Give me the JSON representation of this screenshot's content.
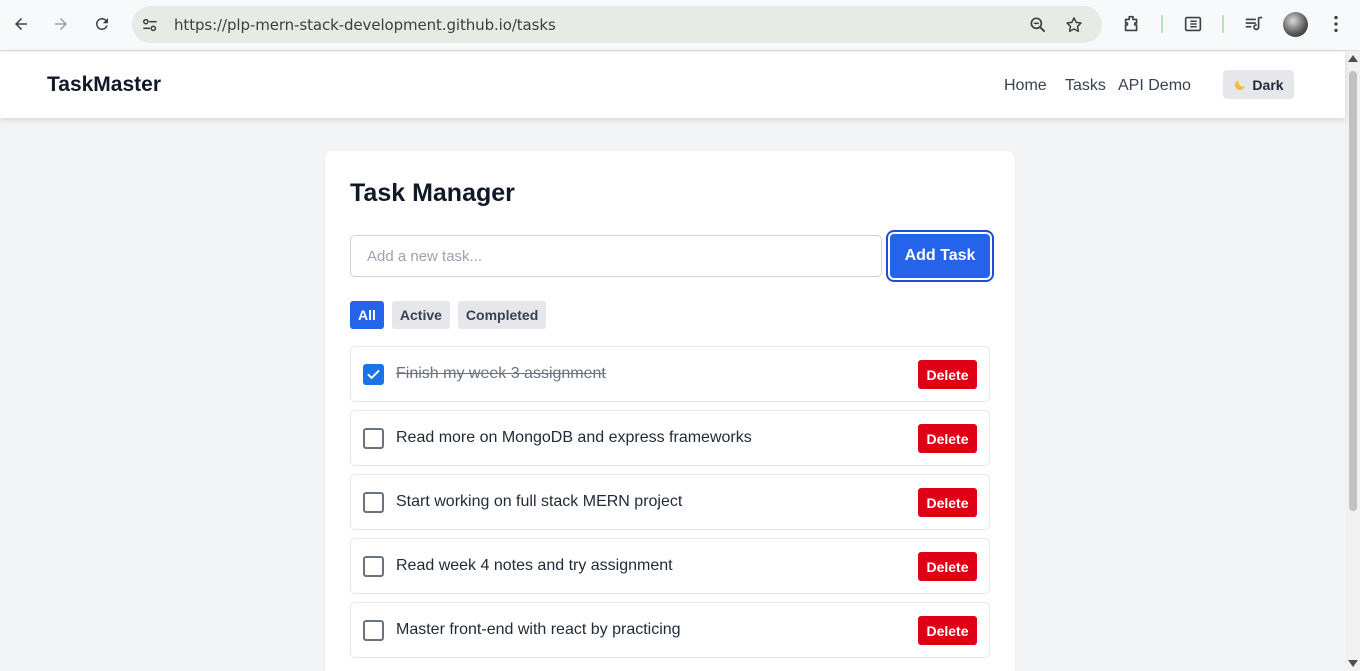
{
  "browser": {
    "url": "https://plp-mern-stack-development.github.io/tasks"
  },
  "header": {
    "brand": "TaskMaster",
    "nav": [
      "Home",
      "Tasks",
      "API Demo"
    ],
    "theme_toggle_label": "Dark"
  },
  "main": {
    "title": "Task Manager",
    "input_placeholder": "Add a new task...",
    "add_button_label": "Add Task",
    "filters": [
      {
        "label": "All",
        "selected": true
      },
      {
        "label": "Active",
        "selected": false
      },
      {
        "label": "Completed",
        "selected": false
      }
    ],
    "tasks": [
      {
        "text": "Finish my week 3 assignment",
        "completed": true,
        "delete_label": "Delete"
      },
      {
        "text": "Read more on MongoDB and express frameworks",
        "completed": false,
        "delete_label": "Delete"
      },
      {
        "text": "Start working on full stack MERN project",
        "completed": false,
        "delete_label": "Delete"
      },
      {
        "text": "Read week 4 notes and try assignment",
        "completed": false,
        "delete_label": "Delete"
      },
      {
        "text": "Master front-end with react by practicing",
        "completed": false,
        "delete_label": "Delete"
      }
    ]
  },
  "colors": {
    "primary": "#2563eb",
    "danger": "#e00016",
    "page_bg": "#f3f4f6"
  }
}
